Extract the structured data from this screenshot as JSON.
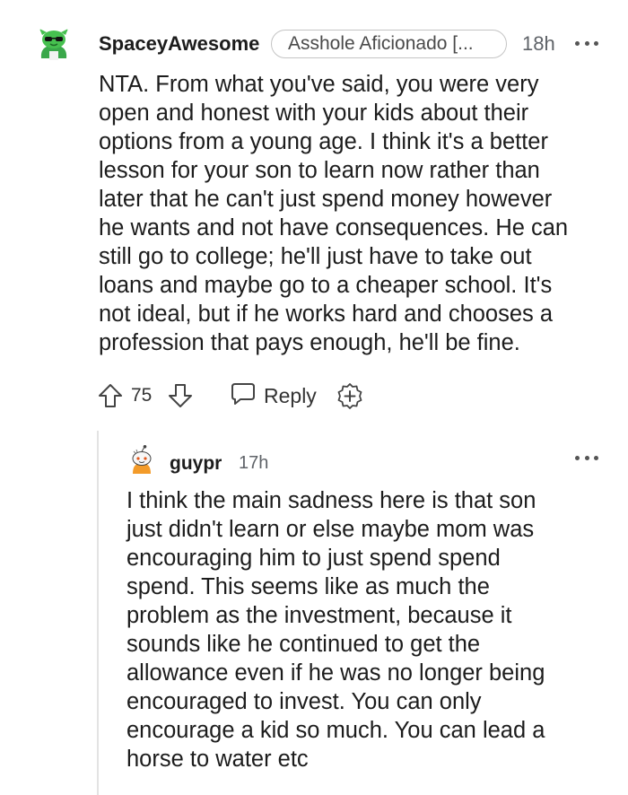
{
  "comments": [
    {
      "username": "SpaceyAwesome",
      "flair": "Asshole Aficionado [...",
      "time": "18h",
      "avatar_icon": "snoo-green-sunglasses-avatar",
      "body_lines": [
        "NTA. From what you've said, you were very",
        "open and honest with your kids about their",
        "options from a young age. I think it's a better",
        "lesson for your son to learn now rather than",
        "later that he can't just spend money however",
        "he wants and not have consequences. He can",
        "still go to college; he'll just have to take out",
        "loans and maybe go to a cheaper school. It's",
        "not ideal, but if he works hard and chooses a",
        "profession that pays enough, he'll be fine."
      ],
      "actions": {
        "score": "75",
        "reply_label": "Reply",
        "upvote_icon": "arrow-up-icon",
        "downvote_icon": "arrow-down-icon",
        "reply_icon": "chat-bubble-icon",
        "award_icon": "award-plus-icon"
      }
    },
    {
      "username": "guypr",
      "time": "17h",
      "avatar_icon": "snoo-orange-avatar",
      "body_lines": [
        "I think the main sadness here is that son",
        "just didn't learn or else maybe mom was",
        "encouraging him to just spend spend",
        "spend. This seems like as much the",
        "problem as the investment, because it",
        "sounds like he continued to get the",
        "allowance even if he was no longer being",
        "encouraged to invest. You can only",
        "encourage a kid so much. You can lead a",
        "horse to water etc"
      ]
    }
  ],
  "colors": {
    "text": "#1c1c1c",
    "meta": "#5f6368",
    "thread_line": "#e3e3e3",
    "flair_border": "#c4c4c4"
  }
}
